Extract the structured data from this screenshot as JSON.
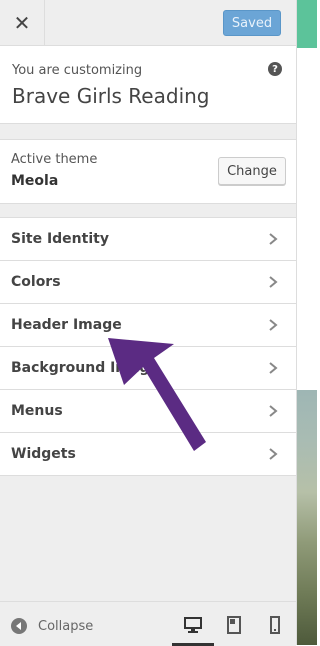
{
  "header": {
    "close_symbol": "✕",
    "saved_label": "Saved"
  },
  "info": {
    "caption": "You are customizing",
    "site_title": "Brave Girls Reading",
    "help_symbol": "?"
  },
  "theme": {
    "label": "Active theme",
    "name": "Meola",
    "change_label": "Change"
  },
  "sections": [
    {
      "label": "Site Identity"
    },
    {
      "label": "Colors"
    },
    {
      "label": "Header Image"
    },
    {
      "label": "Background Image"
    },
    {
      "label": "Menus"
    },
    {
      "label": "Widgets"
    }
  ],
  "footer": {
    "collapse_label": "Collapse",
    "devices": [
      "desktop",
      "tablet",
      "mobile"
    ],
    "active_device": "desktop"
  },
  "colors": {
    "accent_arrow": "#5b2b83",
    "saved_button": "#6ba5d6",
    "preview_band": "#5cc39a"
  },
  "icons": {
    "close": "close-icon",
    "help": "help-icon",
    "chevron": "chevron-right-icon",
    "collapse": "collapse-arrow-icon",
    "desktop": "desktop-icon",
    "tablet": "tablet-icon",
    "mobile": "mobile-icon",
    "annotation": "arrow-annotation-icon"
  }
}
